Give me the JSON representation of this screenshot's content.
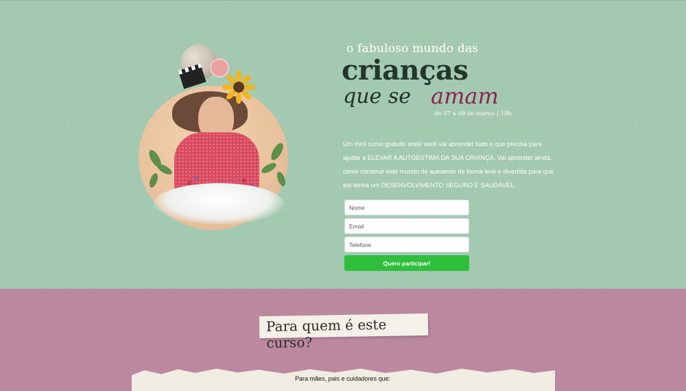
{
  "hero": {
    "title_small": "o fabuloso mundo das",
    "title_big": "crianças",
    "title_script_1": "que se",
    "title_script_2": "amam",
    "date_line": "de 07 a 09 de março | 19h",
    "description": "Um mini curso gratuito onde você vai aprender tudo o que precisa para ajudar a ELEVAR A AUTOESTIMA DA SUA CRIANÇA. Vai aprender ainda, como construir este mundo de autoamor de forma leve e divertida para que ela tenha um DESENVOLVIMENTO SEGURO E SAUDÁVEL."
  },
  "form": {
    "name_placeholder": "Nome",
    "email_placeholder": "Email",
    "phone_placeholder": "Telefone",
    "submit_label": "Quero participar!"
  },
  "section2": {
    "title": "Para quem é este curso?",
    "paper_text": "Para mães, pais e cuidadores que:"
  },
  "colors": {
    "hero_bg": "#a3c9b1",
    "section2_bg": "#bb88a0",
    "accent_script": "#8a2452",
    "button_green": "#2fbf3d"
  }
}
